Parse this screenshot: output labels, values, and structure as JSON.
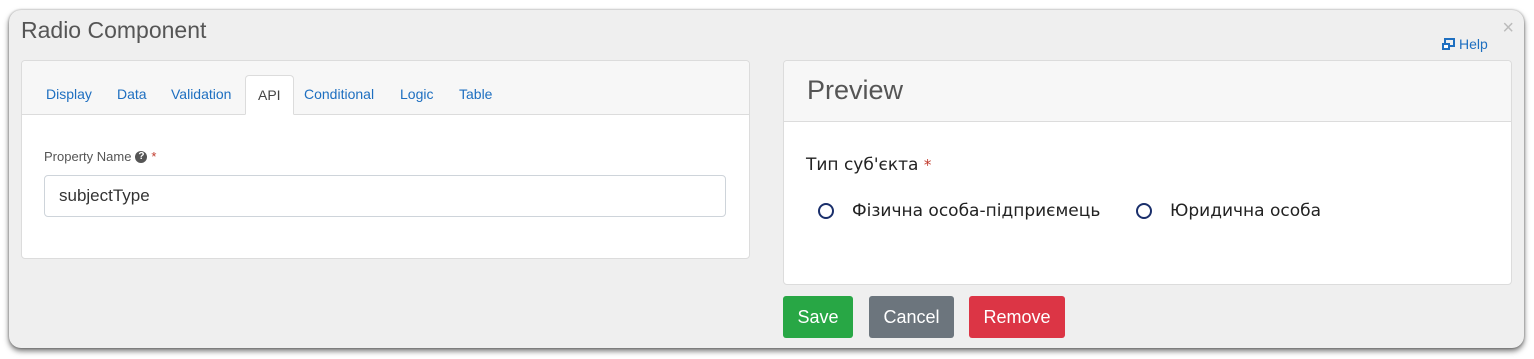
{
  "dialog": {
    "title": "Radio Component",
    "close_glyph": "×",
    "help_label": "Help",
    "help_icon": "external-link-icon"
  },
  "tabs": [
    {
      "label": "Display",
      "active": false
    },
    {
      "label": "Data",
      "active": false
    },
    {
      "label": "Validation",
      "active": false
    },
    {
      "label": "API",
      "active": true
    },
    {
      "label": "Conditional",
      "active": false
    },
    {
      "label": "Logic",
      "active": false
    },
    {
      "label": "Table",
      "active": false
    }
  ],
  "api": {
    "property_name_label": "Property Name",
    "required_mark": "*",
    "property_name_value": "subjectType"
  },
  "preview": {
    "title": "Preview",
    "radio_label": "Тип суб'єкта",
    "required_mark": "*",
    "options": [
      "Фізична особа-підприємець",
      "Юридична особа"
    ]
  },
  "buttons": {
    "save": "Save",
    "cancel": "Cancel",
    "remove": "Remove"
  },
  "colors": {
    "link": "#1e6fc0",
    "save": "#28a745",
    "cancel": "#6c757d",
    "remove": "#dc3545",
    "required": "#c0392b"
  }
}
